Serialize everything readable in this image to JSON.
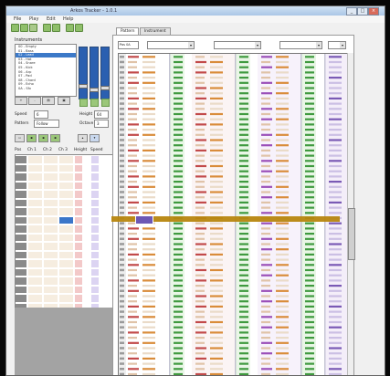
{
  "window": {
    "title": "Arkos Tracker - 1.0.1"
  },
  "menu": [
    "File",
    "Play",
    "Edit",
    "Help"
  ],
  "toolbar": {
    "icons": [
      "new-icon",
      "open-icon",
      "save-icon",
      "play-icon",
      "stop-icon",
      "pattern-icon",
      "record-icon"
    ]
  },
  "left": {
    "instruments_label": "Instruments",
    "instruments": [
      "00 - Empty",
      "01 - Bass",
      "02 - Lead",
      "03 - Hat",
      "04 - Snare",
      "05 - Kick",
      "06 - Arp",
      "07 - Pad",
      "08 - Chord",
      "09 - Echo",
      "0A - Sfx"
    ],
    "selected_instrument": 2,
    "speed_label": "Speed",
    "speed_value": "6",
    "height_label": "Height",
    "height_value": "64",
    "octave_label": "Octave",
    "octave_value": "3",
    "mode_label": "Pattern",
    "mode_value": "Follow",
    "order_headers": [
      "Pos",
      "Ch 1",
      "Ch 2",
      "Ch 3",
      "Height",
      "Speed"
    ]
  },
  "tabs": [
    "Pattern",
    "Instrument"
  ],
  "pattern": {
    "position_label": "Pos 0A",
    "track_labels": [
      "Track 1",
      "Track 2",
      "Track 3"
    ],
    "fx_label": "Fx"
  },
  "colors": {
    "accent": "#3b76c9",
    "cursor_row": "#b7860f",
    "cursor_cell": "#6d58b5",
    "vol_green": "#3f9a3f",
    "note_red": "#c24a4a",
    "fx_purple": "#7a5ab5"
  }
}
